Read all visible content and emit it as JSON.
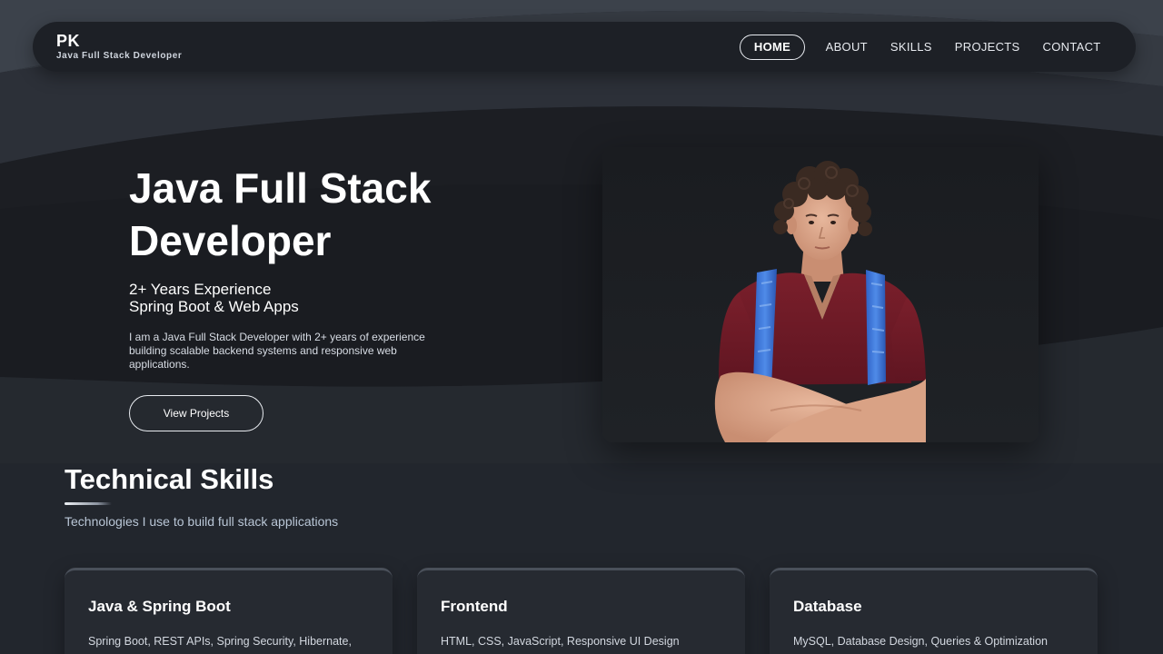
{
  "nav": {
    "brand": "PK",
    "tagline": "Java Full Stack Developer",
    "links": [
      "HOME",
      "ABOUT",
      "SKILLS",
      "PROJECTS",
      "CONTACT"
    ],
    "active": "HOME"
  },
  "hero": {
    "title": "Java Full Stack Developer",
    "subtitle_line1": "2+ Years Experience",
    "subtitle_line2": "Spring Boot & Web Apps",
    "description": "I am a Java Full Stack Developer with 2+ years of experience building scalable backend systems and responsive web applications.",
    "button_label": "View Projects"
  },
  "skills": {
    "heading": "Technical Skills",
    "subtitle": "Technologies I use to build full stack applications",
    "cards": [
      {
        "title": "Java & Spring Boot",
        "description": "Spring Boot, REST APIs, Spring Security, Hibernate, JPA"
      },
      {
        "title": "Frontend",
        "description": "HTML, CSS, JavaScript, Responsive UI Design"
      },
      {
        "title": "Database",
        "description": "MySQL, Database Design, Queries & Optimization"
      }
    ]
  },
  "colors": {
    "background": "#22262d",
    "navbar": "#1d2026",
    "card": "#262a31",
    "text": "#ffffff",
    "muted": "#b9c6d6"
  }
}
